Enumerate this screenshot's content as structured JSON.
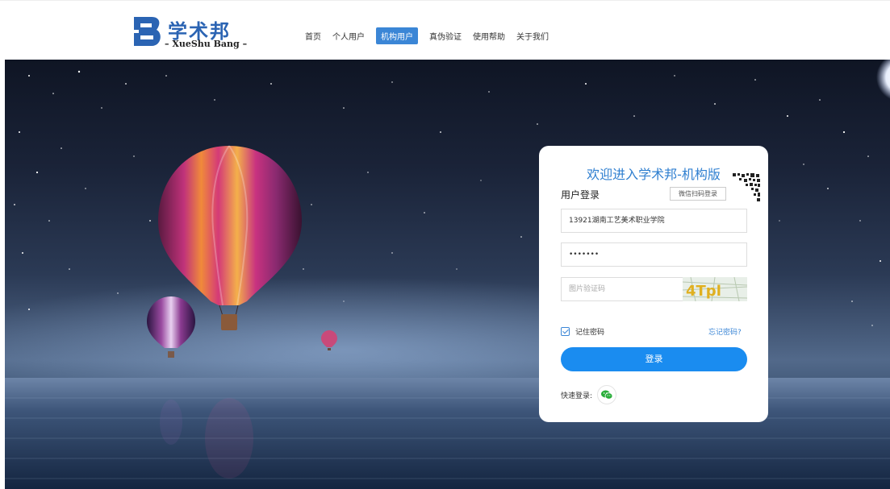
{
  "brand": {
    "name_cn": "学术邦",
    "name_en": "– XueShu Bang –",
    "colors": {
      "primary": "#2b64b3",
      "accent": "#1a8cf0"
    }
  },
  "nav": {
    "items": [
      {
        "label": "首页"
      },
      {
        "label": "个人用户"
      },
      {
        "label": "机构用户",
        "active": true
      },
      {
        "label": "真伪验证"
      },
      {
        "label": "使用帮助"
      },
      {
        "label": "关于我们"
      }
    ]
  },
  "login": {
    "title": "欢迎进入学术邦-机构版",
    "subtitle": "用户登录",
    "wechat_scan_label": "微信扫码登录",
    "username_value": "13921湖南工艺美术职业学院",
    "password_value": "•••••••",
    "captcha_placeholder": "图片验证码",
    "captcha_text": "4Tpl",
    "remember_label": "记住密码",
    "remember_checked": true,
    "forgot_label": "忘记密码?",
    "submit_label": "登录",
    "quick_login_label": "快速登录:",
    "quick_login_icon": "wechat-icon"
  }
}
